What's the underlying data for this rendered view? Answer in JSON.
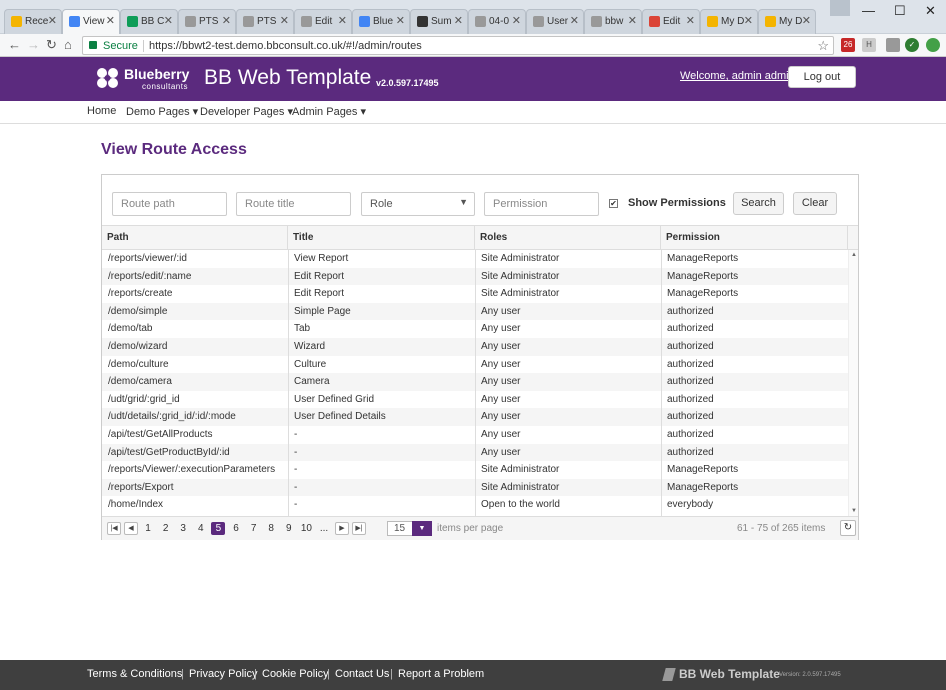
{
  "browser": {
    "tabs": [
      {
        "label": "Rece",
        "fav": "#f4b400"
      },
      {
        "label": "View",
        "fav": "#4285f4"
      },
      {
        "label": "BB C",
        "fav": "#0f9d58"
      },
      {
        "label": "PTS",
        "fav": "#999999"
      },
      {
        "label": "PTS",
        "fav": "#999999"
      },
      {
        "label": "Edit",
        "fav": "#999999"
      },
      {
        "label": "Blue",
        "fav": "#4285f4"
      },
      {
        "label": "Sum",
        "fav": "#333333"
      },
      {
        "label": "04-0",
        "fav": "#999999"
      },
      {
        "label": "User",
        "fav": "#999999"
      },
      {
        "label": "bbw",
        "fav": "#999999"
      },
      {
        "label": "Edit",
        "fav": "#db4437"
      },
      {
        "label": "My D",
        "fav": "#f4b400"
      },
      {
        "label": "My D",
        "fav": "#f4b400"
      }
    ],
    "secure_label": "Secure",
    "url": "https://bbwt2-test.demo.bbconsult.co.uk/#!/admin/routes"
  },
  "header": {
    "brand_name": "Blueberry",
    "brand_sub": "consultants",
    "app_title": "BB Web Template",
    "app_version": "v2.0.597.17495",
    "welcome": "Welcome, admin admin",
    "logout": "Log out"
  },
  "nav": {
    "home": "Home",
    "demo": "Demo Pages ▾",
    "dev": "Developer Pages ▾",
    "admin": "Admin Pages ▾"
  },
  "page_title": "View Route Access",
  "filters": {
    "route_path_placeholder": "Route path",
    "route_title_placeholder": "Route title",
    "role_selected": "Role",
    "permission_placeholder": "Permission",
    "show_permissions_label": "Show Permissions",
    "show_permissions_checked": true,
    "search": "Search",
    "clear": "Clear"
  },
  "grid": {
    "columns": [
      "Path",
      "Title",
      "Roles",
      "Permission"
    ],
    "rows": [
      [
        "/reports/viewer/:id",
        "View Report",
        "Site Administrator",
        "ManageReports"
      ],
      [
        "/reports/edit/:name",
        "Edit Report",
        "Site Administrator",
        "ManageReports"
      ],
      [
        "/reports/create",
        "Edit Report",
        "Site Administrator",
        "ManageReports"
      ],
      [
        "/demo/simple",
        "Simple Page",
        "Any user",
        "authorized"
      ],
      [
        "/demo/tab",
        "Tab",
        "Any user",
        "authorized"
      ],
      [
        "/demo/wizard",
        "Wizard",
        "Any user",
        "authorized"
      ],
      [
        "/demo/culture",
        "Culture",
        "Any user",
        "authorized"
      ],
      [
        "/demo/camera",
        "Camera",
        "Any user",
        "authorized"
      ],
      [
        "/udt/grid/:grid_id",
        "User Defined Grid",
        "Any user",
        "authorized"
      ],
      [
        "/udt/details/:grid_id/:id/:mode",
        "User Defined Details",
        "Any user",
        "authorized"
      ],
      [
        "/api/test/GetAllProducts",
        "-",
        "Any user",
        "authorized"
      ],
      [
        "/api/test/GetProductById/:id",
        "-",
        "Any user",
        "authorized"
      ],
      [
        "/reports/Viewer/:executionParameters",
        "-",
        "Site Administrator",
        "ManageReports"
      ],
      [
        "/reports/Export",
        "-",
        "Site Administrator",
        "ManageReports"
      ],
      [
        "/home/Index",
        "-",
        "Open to the world",
        "everybody"
      ]
    ]
  },
  "pager": {
    "pages": [
      "1",
      "2",
      "3",
      "4",
      "5",
      "6",
      "7",
      "8",
      "9",
      "10",
      "..."
    ],
    "current": "5",
    "items_per_page": "15",
    "items_per_page_label": "items per page",
    "info": "61 - 75 of 265 items"
  },
  "footer": {
    "links": [
      "Terms & Conditions",
      "Privacy Policy",
      "Cookie Policy",
      "Contact Us",
      "Report a Problem"
    ],
    "title": "BB Web Template",
    "version": "Version: 2.0.597.17495"
  },
  "colors": {
    "brand": "#5b2a7e",
    "footer": "#3f3f3f",
    "secure": "#0b8043"
  }
}
